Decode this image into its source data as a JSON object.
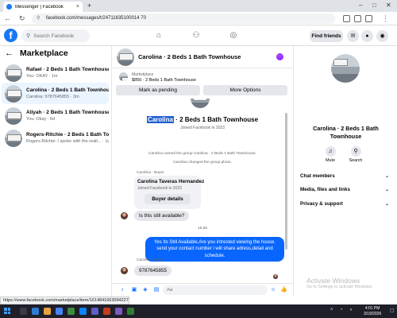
{
  "browser": {
    "tab_title": "Messenger | Facebook",
    "tab_close": "×",
    "new_tab": "+",
    "url": "facebook.com/messages/t/24711635100014 70",
    "status_url": "https://www.facebook.com/marketplace/item/1614841663094227/?referralS..."
  },
  "fb": {
    "logo": "f",
    "search_placeholder": "Search Facebook",
    "find_friends": "Find friends"
  },
  "marketplace": {
    "title": "Marketplace",
    "conversations": [
      {
        "name": "Rafael · 2 Beds 1 Bath Townhouse",
        "preview": "You: OKAY · 1m"
      },
      {
        "name": "Carolina · 2 Beds 1 Bath Townhouse",
        "preview": "Carolina: 9787645855 · 3m"
      },
      {
        "name": "Aliyah · 2 Beds 1 Bath Townhouse",
        "preview": "You: Okay · 6d"
      },
      {
        "name": "Rogers-Ritchie · 2 Beds 1 Bath Towho...",
        "preview": "Rogers-Ritchie: I spoke with the realt... · 1w"
      }
    ]
  },
  "chat": {
    "title": "Carolina · 2 Beds 1 Bath Townhouse",
    "listing_label": "Marketplace",
    "listing_price": "$850 · 2 Beds 1 Bath Townhouse",
    "mark_pending": "Mark as pending",
    "more_options": "More Options",
    "header_name_highlight": "Carolina",
    "header_name_rest": " · 2 Beds 1 Bath Townhouse",
    "joined": "Joined Facebook in 2023",
    "sys1": "Carolina named the group Carolina · 2 Beds 1 Bath Townhouse.",
    "sys2": "Carolina changed the group photo.",
    "sender1": "Carolina · Buyer",
    "card_name": "Carolina Taveras Hernandez",
    "card_joined": "Joined Facebook in 2023",
    "card_button": "Buyer details",
    "msg_available": "Is this still available?",
    "timestamp": "15:55",
    "msg_out": "Yes Its Still Available,Are you intrested viewing the house. send your contact number i will share adress,detail and schedule.",
    "sender2": "Carolina · Buyer",
    "msg_phone": "9787645855",
    "composer_placeholder": "Aa"
  },
  "details": {
    "name_line1": "Carolina · 2 Beds 1 Bath",
    "name_line2": "Townhouse",
    "mute": "Mute",
    "search": "Search",
    "sections": [
      "Chat members",
      "Media, files and links",
      "Privacy & support"
    ]
  },
  "watermark": {
    "line1": "Activate Windows",
    "line2": "Go to Settings to activate Windows."
  },
  "taskbar": {
    "time": "4:01 PM",
    "date": "3/19/2026"
  },
  "colors": {
    "accent": "#1877f2",
    "bubble_out": "#0866ff",
    "active_conv": "#ebf5ff"
  }
}
